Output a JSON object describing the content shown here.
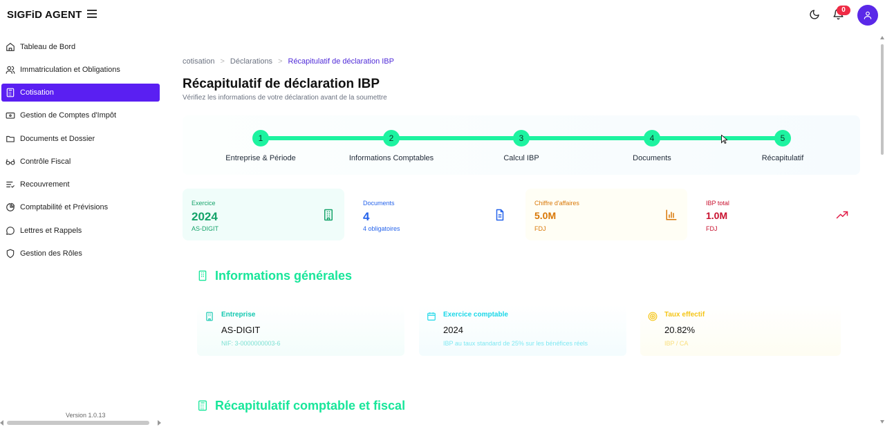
{
  "app": {
    "brand": "SIGFiD AGENT",
    "notif_count": "0",
    "version": "Version 1.0.13"
  },
  "sidebar": {
    "items": [
      {
        "label": "Tableau de Bord"
      },
      {
        "label": "Immatriculation et Obligations"
      },
      {
        "label": "Cotisation"
      },
      {
        "label": "Gestion de Comptes d'Impôt"
      },
      {
        "label": "Documents et Dossier"
      },
      {
        "label": "Contrôle Fiscal"
      },
      {
        "label": "Recouvrement"
      },
      {
        "label": "Comptabilité et Prévisions"
      },
      {
        "label": "Lettres et Rappels"
      },
      {
        "label": "Gestion des Rôles"
      }
    ]
  },
  "breadcrumb": {
    "items": [
      "cotisation",
      "Déclarations",
      "Récapitulatif de déclaration IBP"
    ],
    "sep": ">"
  },
  "page": {
    "title": "Récapitulatif de déclaration IBP",
    "subtitle": "Vérifiez les informations de votre déclaration avant de la soumettre"
  },
  "stepper": {
    "steps": [
      {
        "num": "1",
        "label": "Entreprise & Période"
      },
      {
        "num": "2",
        "label": "Informations Comptables"
      },
      {
        "num": "3",
        "label": "Calcul IBP"
      },
      {
        "num": "4",
        "label": "Documents"
      },
      {
        "num": "5",
        "label": "Récapitulatif"
      }
    ]
  },
  "cards": [
    {
      "label": "Exercice",
      "value": "2024",
      "sub": "AS-DIGIT",
      "color": "#15a36a",
      "bg": "#f0fdfa",
      "icon": "building-icon"
    },
    {
      "label": "Documents",
      "value": "4",
      "sub": "4 obligatoires",
      "color": "#2563eb",
      "bg": "#ffffff",
      "icon": "file-icon"
    },
    {
      "label": "Chiffre d'affaires",
      "value": "5.0M",
      "sub": "FDJ",
      "color": "#d97706",
      "bg": "#fffef5",
      "icon": "bar-chart-icon"
    },
    {
      "label": "IBP total",
      "value": "1.0M",
      "sub": "FDJ",
      "color": "#c8102e",
      "bg": "#ffffff",
      "icon": "trend-up-icon"
    }
  ],
  "sections": {
    "general": "Informations générales",
    "summary": "Récapitulatif comptable et fiscal"
  },
  "info": [
    {
      "head": "Entreprise",
      "value": "AS-DIGIT",
      "sub": "NIF: 3-0000000003-6",
      "color": "#14c8b0"
    },
    {
      "head": "Exercice comptable",
      "value": "2024",
      "sub": "IBP au taux standard de 25% sur les bénéfices réels",
      "color": "#1ad7e8"
    },
    {
      "head": "Taux effectif",
      "value": "20.82%",
      "sub": "IBP / CA",
      "color": "#f5c518"
    }
  ]
}
